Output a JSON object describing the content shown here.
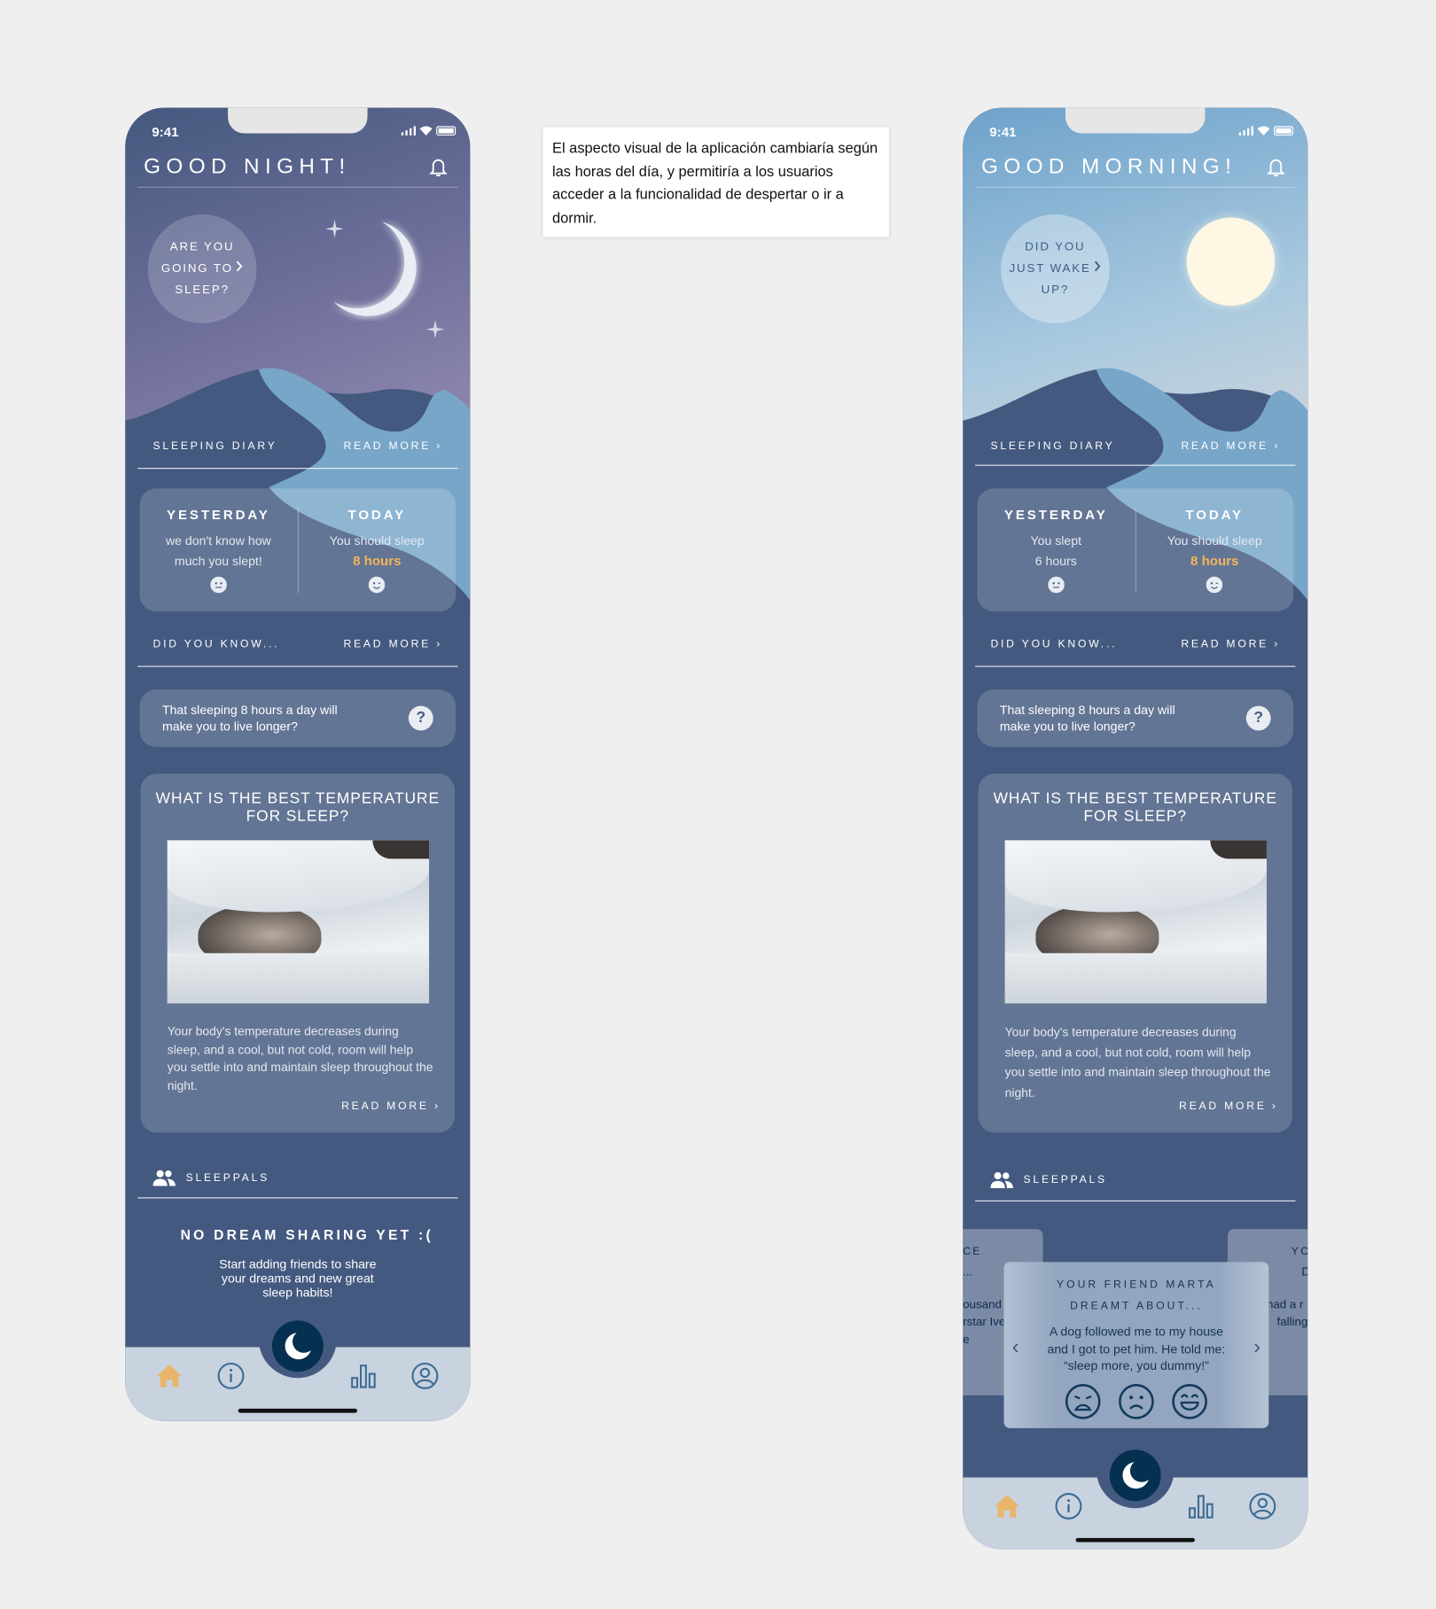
{
  "note": "El aspecto visual de la aplicación cambiaría según las horas del día, y permitiría a los usuarios acceder a la funcionalidad de despertar o ir a dormir.",
  "colors": {
    "accent": "#f3b55b",
    "base": "#44597f",
    "nav": "#c9d2df",
    "fab": "#05304f"
  },
  "icons": [
    "bell-icon",
    "moon-icon",
    "sun-icon",
    "star-icon",
    "chevron-right-icon",
    "smiley-icon",
    "question-icon",
    "friends-icon",
    "home-icon",
    "info-icon",
    "stats-icon",
    "profile-icon",
    "chevron-left-icon",
    "sad-face-icon",
    "frown-face-icon",
    "grin-face-icon"
  ],
  "night": {
    "status_time": "9:41",
    "title": "GOOD NIGHT!",
    "bubble": [
      "ARE YOU",
      "GOING TO",
      "SLEEP?"
    ],
    "diary_label": "SLEEPING DIARY",
    "read_more": "READ MORE",
    "yesterday": {
      "title": "YESTERDAY",
      "l1": "we don't know how",
      "l2": "much you slept!"
    },
    "today": {
      "title": "TODAY",
      "l1": "You should sleep",
      "l2": "8 hours"
    },
    "dyk_label": "DID YOU KNOW...",
    "fact": "That sleeping 8 hours a day will make you to live longer?",
    "fact_icon": "?",
    "temp_title": "WHAT IS THE BEST TEMPERATURE FOR SLEEP?",
    "temp_body": "Your body's temperature decreases during sleep, and a cool, but not cold, room will help you settle into and maintain sleep throughout the night.",
    "pals_label": "SLEEPPALS",
    "nodream_title": "NO DREAM SHARING YET :(",
    "nodream_text": "Start adding friends to share your dreams and new great sleep habits!"
  },
  "morning": {
    "status_time": "9:41",
    "title": "GOOD MORNING!",
    "bubble": [
      "DID YOU",
      "JUST WAKE",
      "UP?"
    ],
    "diary_label": "SLEEPING DIARY",
    "read_more": "READ MORE",
    "yesterday": {
      "title": "YESTERDAY",
      "l1": "You slept",
      "l2": "6 hours"
    },
    "today": {
      "title": "TODAY",
      "l1": "You should sleep",
      "l2": "8 hours"
    },
    "dyk_label": "DID YOU KNOW...",
    "fact": "That sleeping 8 hours a day will make you to live longer?",
    "fact_icon": "?",
    "temp_title": "WHAT IS THE BEST TEMPERATURE FOR SLEEP?",
    "temp_body": "Your body's temperature decreases during sleep, and a cool, but not cold, room will help you settle into and maintain sleep throughout the night.",
    "pals_label": "SLEEPPALS",
    "dream": {
      "title": "YOUR FRIEND MARTA DREAMT ABOUT...",
      "text": "A dog followed me to my house and I got to pet him. He told me: “sleep more, you dummy!”"
    },
    "side_left": [
      "CE",
      "...",
      "ousand",
      "rstar Ive",
      "e"
    ],
    "side_right": [
      "YC",
      "D",
      "had a r",
      "falling"
    ]
  }
}
